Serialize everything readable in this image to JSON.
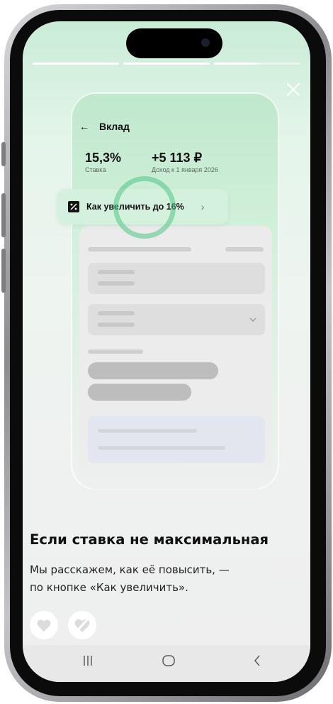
{
  "mock": {
    "title": "Вклад",
    "rate_value": "15,3%",
    "rate_caption": "Ставка",
    "income_value": "+5 113 ₽",
    "income_caption": "Доход к 1 января 2026",
    "pill_label": "Как увеличить до 16%"
  },
  "story": {
    "progress": [
      1,
      1,
      0.5
    ],
    "headline": "Если ставка не максимальная",
    "body_line1": "Мы расскажем, как её повысить, —",
    "body_line2": "по кнопке «Как увеличить»."
  },
  "icons": {
    "close": "close-icon",
    "like": "heart-icon",
    "dislike": "dislike-icon",
    "back": "arrow-left-icon",
    "percent": "percent-icon",
    "chevron": "chevron-right-icon"
  },
  "colors": {
    "accent_green": "#4ec687",
    "mock_green": "#bfe8cd"
  }
}
